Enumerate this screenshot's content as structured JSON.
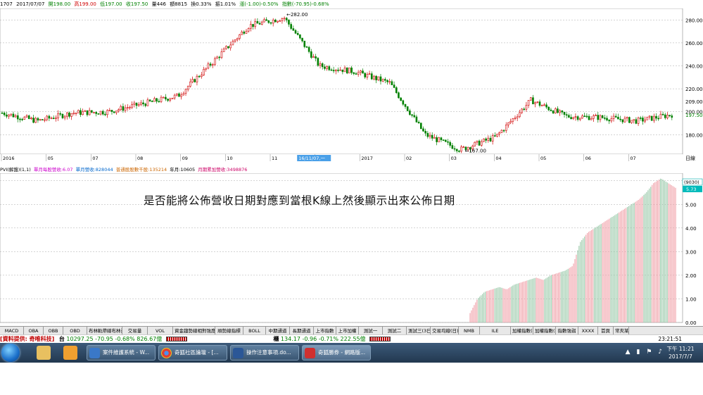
{
  "info_bar": {
    "code": "1707",
    "date": "2017/07/07",
    "open": "開198.00",
    "high": "高199.00",
    "low": "低197.00",
    "close": "收197.50",
    "volume": "量446",
    "amount": "額8815",
    "change_rate": "換0.33%",
    "amplitude": "振1.01%",
    "change": "漲(-1.00)-0.50%",
    "index": "指數(-70.95)-0.68%"
  },
  "price_axis": [
    "280.00",
    "260.00",
    "240.00",
    "220.00",
    "209.00",
    "200.00",
    "180.00"
  ],
  "price_marker": "197.50",
  "month_labels": [
    "2016",
    "05",
    "07",
    "08",
    "09",
    "10",
    "11",
    "12",
    "2017",
    "02",
    "03",
    "04",
    "05",
    "06",
    "07"
  ],
  "highlighted_date": "16/11/07,一",
  "axis_corner": "日線",
  "annotations": {
    "high": "282.00",
    "low": "167.00"
  },
  "volume_legend": {
    "title": "PVI(解盤)(1,1)",
    "items": [
      "單月每股營收:6.07",
      "單月營收:828044",
      "普通股股數千股:135214",
      "年月:10605",
      "月期累加營收:3498876"
    ]
  },
  "volume_axis": [
    "6.00",
    "5.00",
    "4.00",
    "3.00",
    "2.00",
    "1.00",
    "0.00"
  ],
  "volume_markers": {
    "box": "(9030)",
    "value": "5.73"
  },
  "question": "是否能將公佈營收日期對應到當根K線上然後顯示出來公佈日期",
  "tabs": [
    "MACD",
    "OBA",
    "OBB",
    "OBD",
    "布林軌帶線布林通",
    "交易量",
    "VOL",
    "資金趨勢線相對強度",
    "順勢線指標",
    "BOLL",
    "中期通道",
    "長期通道",
    "上市指數",
    "上市加權",
    "測試一",
    "測試二",
    "測試三(3日)",
    "交易均線(日)",
    "NMB",
    "ILE",
    "加權指數(強)",
    "加權指數(弱)",
    "指數強弱",
    "XXXX",
    "首頁",
    "常夾某"
  ],
  "ticker": {
    "source": "[資料提供: 奇唯科技]",
    "label_tw": "台",
    "tw_values": "10297.25 -70.95 -0.68% 826.67億",
    "label_otc": "櫃",
    "otc_values": "134.17 -0.96 -0.71% 222.55億",
    "time": "23:21:51"
  },
  "taskbar": {
    "items": [
      "案件維護系統 - W...",
      "奇狐社區論壇 - [...",
      "操作注意事項.do...",
      "奇狐勝券 - 網路版..."
    ],
    "time": "下午 11:21",
    "date": "2017/7/7"
  },
  "colors": {
    "up": "#d00000",
    "down": "#008000",
    "up_vol": "#f0a0a8",
    "down_vol": "#98c8a8"
  },
  "chart_data": [
    {
      "type": "candlestick",
      "xlabel": "",
      "ylabel": "",
      "ylim": [
        163,
        290
      ],
      "x_labels": [
        "2016",
        "05",
        "07",
        "08",
        "09",
        "10",
        "11",
        "12",
        "2017",
        "02",
        "03",
        "04",
        "05",
        "06",
        "07"
      ],
      "series_path_approx": [
        {
          "period": "2016 start",
          "close": 199
        },
        {
          "period": "2016-04",
          "close": 192
        },
        {
          "period": "2016-05",
          "close": 199
        },
        {
          "period": "2016-06",
          "close": 200
        },
        {
          "period": "2016-07",
          "close": 207
        },
        {
          "period": "2016-08",
          "close": 214
        },
        {
          "period": "2016-09",
          "close": 244
        },
        {
          "period": "2016-10",
          "close": 275
        },
        {
          "period": "2016-10 high",
          "close": 282
        },
        {
          "period": "2016-11",
          "close": 240
        },
        {
          "period": "2016-12",
          "close": 235
        },
        {
          "period": "2016-12 end",
          "close": 225
        },
        {
          "period": "2017-01 drop",
          "close": 180
        },
        {
          "period": "2017-01 low",
          "close": 167
        },
        {
          "period": "2017-02",
          "close": 178
        },
        {
          "period": "2017-03",
          "close": 210
        },
        {
          "period": "2017-04",
          "close": 196
        },
        {
          "period": "2017-05",
          "close": 195
        },
        {
          "period": "2017-06",
          "close": 192
        },
        {
          "period": "2017-07",
          "close": 197.5
        }
      ]
    },
    {
      "type": "bar",
      "title": "",
      "ylim": [
        0,
        6.2
      ],
      "values_approx": [
        0.4,
        1.0,
        1.3,
        1.4,
        1.5,
        1.4,
        1.6,
        1.7,
        1.8,
        1.9,
        1.8,
        2.0,
        2.1,
        2.2,
        2.4,
        3.4,
        3.8,
        4.0,
        4.2,
        4.4,
        4.6,
        4.8,
        5.0,
        5.2,
        5.5,
        5.9,
        6.1,
        5.9,
        5.7
      ]
    }
  ]
}
